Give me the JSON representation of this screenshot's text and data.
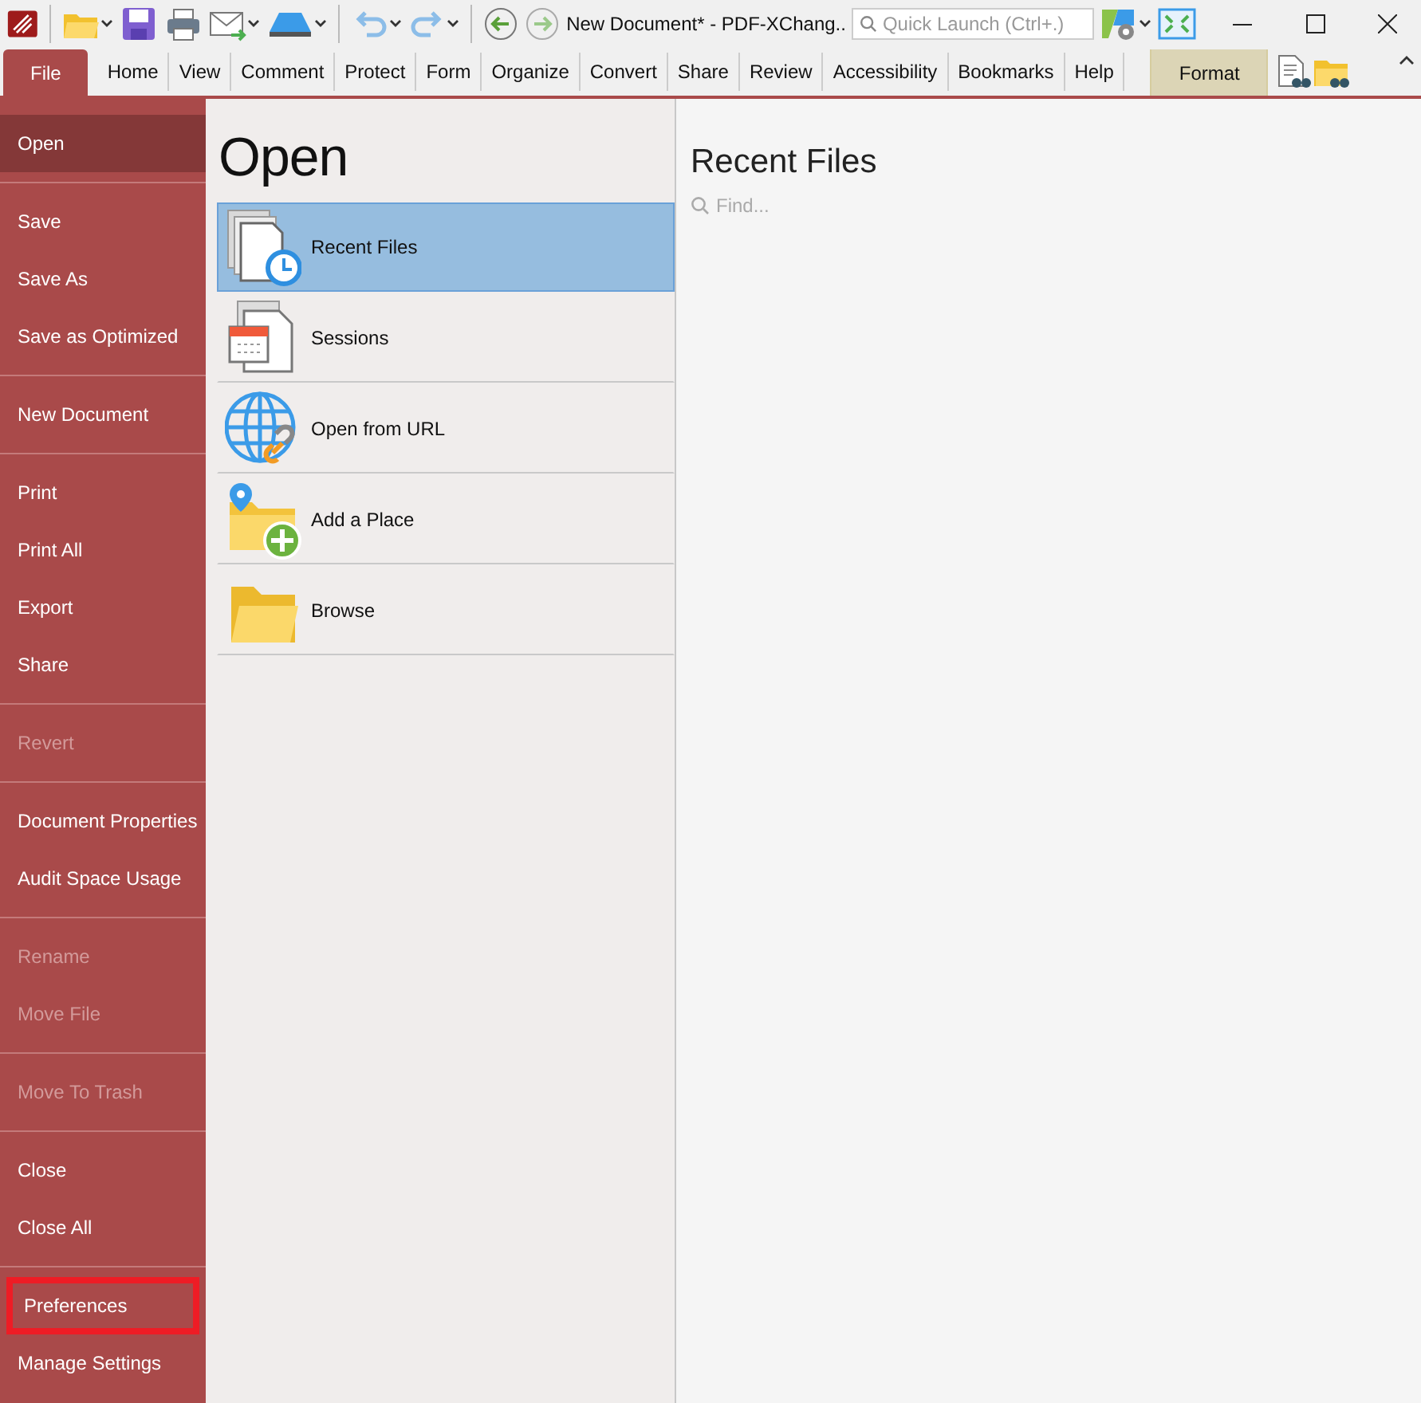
{
  "window": {
    "title": "New Document* - PDF-XChang..",
    "search": {
      "placeholder": "Quick Launch (Ctrl+.)"
    }
  },
  "tabs": [
    {
      "label": "File",
      "kind": "file",
      "selected": true
    },
    {
      "label": "Home",
      "kind": "normal",
      "selected": false
    },
    {
      "label": "View",
      "kind": "normal",
      "selected": false
    },
    {
      "label": "Comment",
      "kind": "normal",
      "selected": false
    },
    {
      "label": "Protect",
      "kind": "normal",
      "selected": false
    },
    {
      "label": "Form",
      "kind": "normal",
      "selected": false
    },
    {
      "label": "Organize",
      "kind": "normal",
      "selected": false
    },
    {
      "label": "Convert",
      "kind": "normal",
      "selected": false
    },
    {
      "label": "Share",
      "kind": "normal",
      "selected": false
    },
    {
      "label": "Review",
      "kind": "normal",
      "selected": false
    },
    {
      "label": "Accessibility",
      "kind": "normal",
      "selected": false
    },
    {
      "label": "Bookmarks",
      "kind": "normal",
      "selected": false
    },
    {
      "label": "Help",
      "kind": "normal",
      "selected": false
    },
    {
      "label": "Format",
      "kind": "contextual",
      "selected": false
    }
  ],
  "sidebar": {
    "groups": [
      [
        {
          "label": "Open",
          "selected": true,
          "disabled": false,
          "highlighted": false
        }
      ],
      [
        {
          "label": "Save",
          "selected": false,
          "disabled": false,
          "highlighted": false
        },
        {
          "label": "Save As",
          "selected": false,
          "disabled": false,
          "highlighted": false
        },
        {
          "label": "Save as Optimized",
          "selected": false,
          "disabled": false,
          "highlighted": false
        }
      ],
      [
        {
          "label": "New Document",
          "selected": false,
          "disabled": false,
          "highlighted": false
        }
      ],
      [
        {
          "label": "Print",
          "selected": false,
          "disabled": false,
          "highlighted": false
        },
        {
          "label": "Print All",
          "selected": false,
          "disabled": false,
          "highlighted": false
        },
        {
          "label": "Export",
          "selected": false,
          "disabled": false,
          "highlighted": false
        },
        {
          "label": "Share",
          "selected": false,
          "disabled": false,
          "highlighted": false
        }
      ],
      [
        {
          "label": "Revert",
          "selected": false,
          "disabled": true,
          "highlighted": false
        }
      ],
      [
        {
          "label": "Document Properties",
          "selected": false,
          "disabled": false,
          "highlighted": false
        },
        {
          "label": "Audit Space Usage",
          "selected": false,
          "disabled": false,
          "highlighted": false
        }
      ],
      [
        {
          "label": "Rename",
          "selected": false,
          "disabled": true,
          "highlighted": false
        },
        {
          "label": "Move File",
          "selected": false,
          "disabled": true,
          "highlighted": false
        }
      ],
      [
        {
          "label": "Move To Trash",
          "selected": false,
          "disabled": true,
          "highlighted": false
        }
      ],
      [
        {
          "label": "Close",
          "selected": false,
          "disabled": false,
          "highlighted": false
        },
        {
          "label": "Close All",
          "selected": false,
          "disabled": false,
          "highlighted": false
        }
      ],
      [
        {
          "label": "Preferences",
          "selected": false,
          "disabled": false,
          "highlighted": true
        },
        {
          "label": "Manage Settings",
          "selected": false,
          "disabled": false,
          "highlighted": false
        }
      ]
    ]
  },
  "open_panel": {
    "heading": "Open",
    "items": [
      {
        "label": "Recent Files",
        "kind": "recent",
        "selected": true
      },
      {
        "label": "Sessions",
        "kind": "sessions",
        "selected": false
      },
      {
        "label": "Open from URL",
        "kind": "url",
        "selected": false
      },
      {
        "label": "Add a Place",
        "kind": "place",
        "selected": false
      },
      {
        "label": "Browse",
        "kind": "browse",
        "selected": false
      }
    ]
  },
  "recent_panel": {
    "heading": "Recent Files",
    "search": {
      "placeholder": "Find..."
    }
  }
}
